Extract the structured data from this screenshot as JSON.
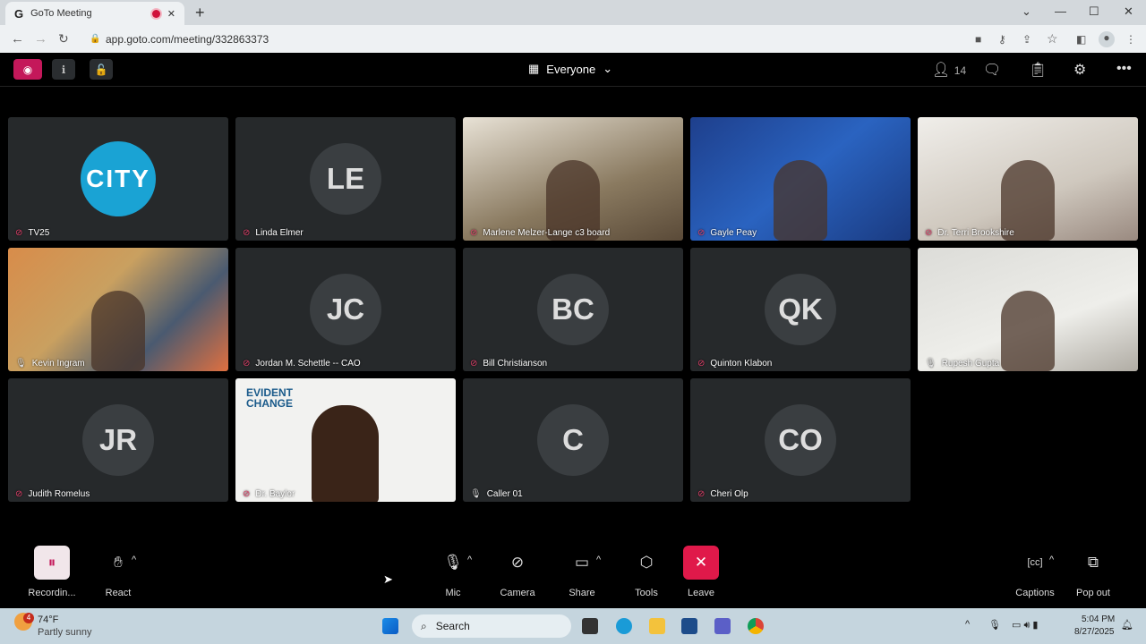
{
  "browser": {
    "tab_title": "GoTo Meeting",
    "url": "app.goto.com/meeting/332863373",
    "favicon": "G"
  },
  "meeting": {
    "layout_label": "Everyone",
    "participant_count": "14"
  },
  "participants": [
    {
      "name": "TV25",
      "initials": "",
      "muted": true,
      "video": "city-logo"
    },
    {
      "name": "Linda Elmer",
      "initials": "LE",
      "muted": true
    },
    {
      "name": "Marlene Melzer-Lange c3 board",
      "initials": "",
      "muted": true,
      "video": "camera"
    },
    {
      "name": "Gayle Peay",
      "initials": "",
      "muted": true,
      "video": "camera"
    },
    {
      "name": "Dr. Terri Brookshire",
      "initials": "",
      "muted": true,
      "video": "camera"
    },
    {
      "name": "Kevin Ingram",
      "initials": "",
      "muted": false,
      "video": "camera"
    },
    {
      "name": "Jordan M. Schettle -- CAO",
      "initials": "JC",
      "muted": true
    },
    {
      "name": "Bill Christianson",
      "initials": "BC",
      "muted": true
    },
    {
      "name": "Quinton Klabon",
      "initials": "QK",
      "muted": true
    },
    {
      "name": "Rupesh Gupta",
      "initials": "",
      "muted": false,
      "video": "camera"
    },
    {
      "name": "Judith Romelus",
      "initials": "JR",
      "muted": true
    },
    {
      "name": "Dr. Baylor",
      "initials": "",
      "muted": true,
      "video": "evident-change"
    },
    {
      "name": "Caller 01",
      "initials": "C",
      "muted": false
    },
    {
      "name": "Cheri Olp",
      "initials": "CO",
      "muted": true
    }
  ],
  "video_text": {
    "city_logo": "CITY",
    "evident": "EVIDENT CHANGE"
  },
  "toolbar": {
    "recording": "Recordin...",
    "react": "React",
    "mic": "Mic",
    "camera": "Camera",
    "share": "Share",
    "tools": "Tools",
    "leave": "Leave",
    "captions": "Captions",
    "popout": "Pop out"
  },
  "taskbar": {
    "weather_temp": "74°F",
    "weather_desc": "Partly sunny",
    "weather_badge": "4",
    "search": "Search",
    "time": "5:04 PM",
    "date": "8/27/2025"
  },
  "colors": {
    "accent": "#c4185a",
    "leave": "#e0194a",
    "muted": "#e0406a"
  }
}
